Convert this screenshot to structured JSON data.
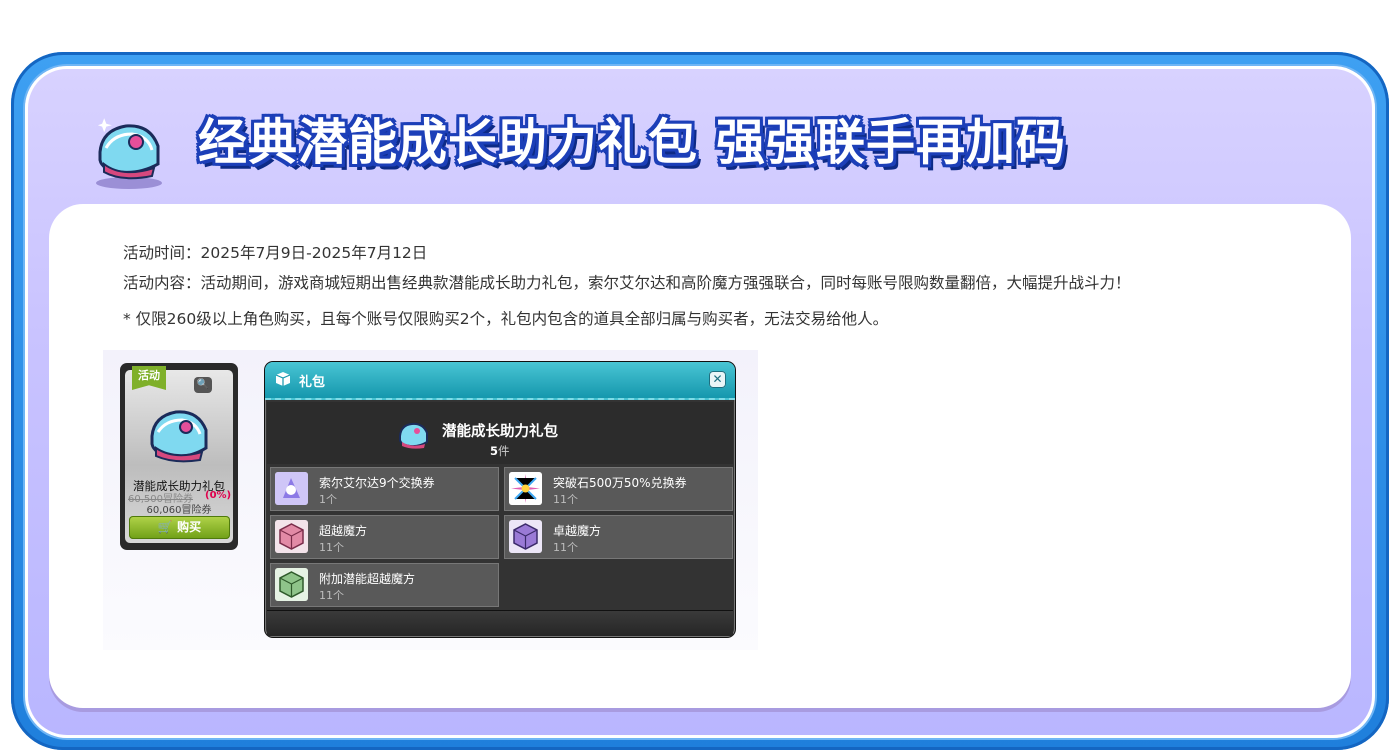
{
  "banner": {
    "title": "经典潜能成长助力礼包 强强联手再加码",
    "icon": "shield-helmet-icon"
  },
  "info": {
    "time": "活动时间：2025年7月9日-2025年7月12日",
    "content": "活动内容：活动期间，游戏商城短期出售经典款潜能成长助力礼包，索尔艾尔达和高阶魔方强强联合，同时每账号限购数量翻倍，大幅提升战斗力！",
    "note": "* 仅限260级以上角色购买，且每个账号仅限购买2个，礼包内包含的道具全部归属与购买者，无法交易给他人。"
  },
  "product_card": {
    "badge": "活动",
    "name": "潜能成长助力礼包",
    "old_price": "60,500冒险券",
    "discount": "(0%)",
    "new_price": "60,060冒险券",
    "buy_label": "购买"
  },
  "gift_window": {
    "title": "礼包",
    "package_name": "潜能成长助力礼包",
    "count_num": "5",
    "count_unit": "件",
    "items": [
      {
        "name": "索尔艾尔达9个交换券",
        "qty": "1个",
        "icon": "sol-erda-ticket-icon",
        "color": "#b9a6f5"
      },
      {
        "name": "突破石500万50%兑换券",
        "qty": "11个",
        "icon": "breakthrough-stone-icon",
        "color": "#e05fb3"
      },
      {
        "name": "超越魔方",
        "qty": "11个",
        "icon": "transcend-cube-icon",
        "color": "#e28aa6"
      },
      {
        "name": "卓越魔方",
        "qty": "11个",
        "icon": "excellence-cube-icon",
        "color": "#9a7ad6"
      },
      {
        "name": "附加潜能超越魔方",
        "qty": "11个",
        "icon": "additional-cube-icon",
        "color": "#8fc48a"
      }
    ]
  }
}
